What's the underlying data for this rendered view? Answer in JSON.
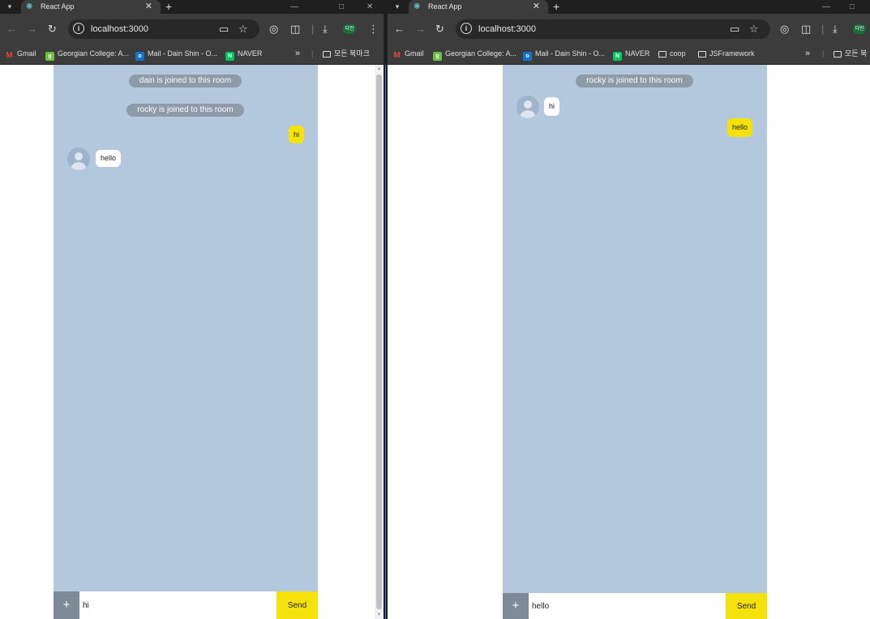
{
  "left": {
    "tab_title": "React App",
    "url": "localhost:3000",
    "profile_label": "다인",
    "bookmarks": [
      "Gmail",
      "Georgian College: A...",
      "Mail - Dain Shin - O...",
      "NAVER"
    ],
    "bookmark_overflow": "»",
    "all_bookmarks": "모든 북마크",
    "system_messages": [
      "dain is joined to this room",
      "rocky is joined to this room"
    ],
    "my_message": "hi",
    "their_message": "hello",
    "input_value": "hi",
    "send_label": "Send",
    "plus_label": "+"
  },
  "right": {
    "tab_title": "React App",
    "url": "localhost:3000",
    "profile_label": "다인",
    "bookmarks": [
      "Gmail",
      "Georgian College: A...",
      "Mail - Dain Shin - O...",
      "NAVER",
      "coop",
      "JSFramework"
    ],
    "bookmark_overflow": "»",
    "all_bookmarks": "모든 북",
    "system_messages": [
      "rocky is joined to this room"
    ],
    "their_message": "hi",
    "my_message": "hello",
    "input_value": "hello",
    "send_label": "Send",
    "plus_label": "+"
  },
  "colors": {
    "chat_background": "#b3c8dc",
    "my_bubble": "#f5e10c",
    "their_bubble": "#ffffff",
    "system_pill": "#8d9aa7",
    "send_button": "#f5e10c",
    "plus_button": "#7d8b99",
    "browser_chrome": "#3c3c3c"
  },
  "icons": {
    "tab_favicon": "react-icon",
    "back": "arrow-left-icon",
    "forward": "arrow-right-icon",
    "reload": "reload-icon",
    "site_info": "info-icon",
    "star": "star-icon",
    "download": "download-icon",
    "extensions": "puzzle-icon",
    "avatar": "default-user-avatar-icon"
  }
}
